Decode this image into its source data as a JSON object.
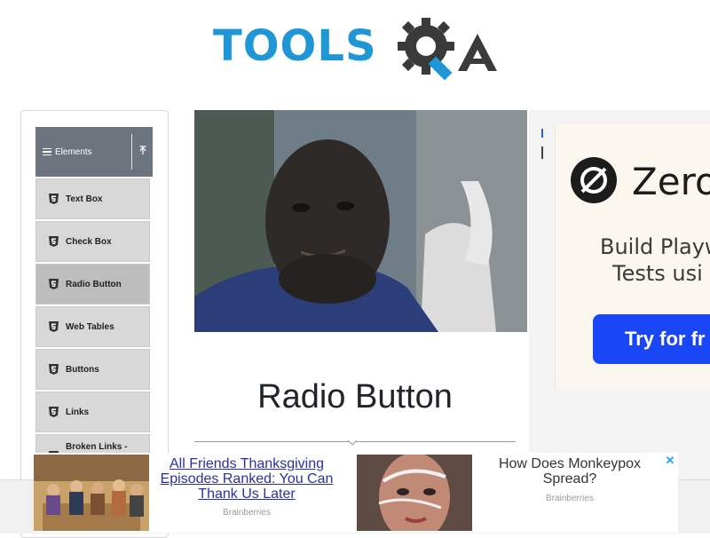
{
  "header": {
    "logo_text": "TOOLS",
    "logo_text_secondary": "QA",
    "brand_color": "#1f96d6"
  },
  "sidebar": {
    "group_label": "Elements",
    "items": [
      {
        "label": "Text Box",
        "icon": "html5-icon"
      },
      {
        "label": "Check Box",
        "icon": "html5-icon"
      },
      {
        "label": "Radio Button",
        "icon": "html5-icon",
        "active": true
      },
      {
        "label": "Web Tables",
        "icon": "html5-icon"
      },
      {
        "label": "Buttons",
        "icon": "html5-icon"
      },
      {
        "label": "Links",
        "icon": "html5-icon"
      },
      {
        "label": "Broken Links -",
        "icon": "html5-icon"
      }
    ]
  },
  "main": {
    "title": "Radio Button"
  },
  "right_ad": {
    "brand": "Zero",
    "line1": "Build Playw",
    "line2": "Tests usi",
    "cta": "Try for fr",
    "cta_color": "#1a47f5"
  },
  "bottom_ad": {
    "headline1": "All Friends Thanksgiving Episodes Ranked: You Can Thank Us Later",
    "source1": "Brainberries",
    "headline2": "How Does Monkeypox Spread?",
    "source2": "Brainberries",
    "close": "✕"
  }
}
